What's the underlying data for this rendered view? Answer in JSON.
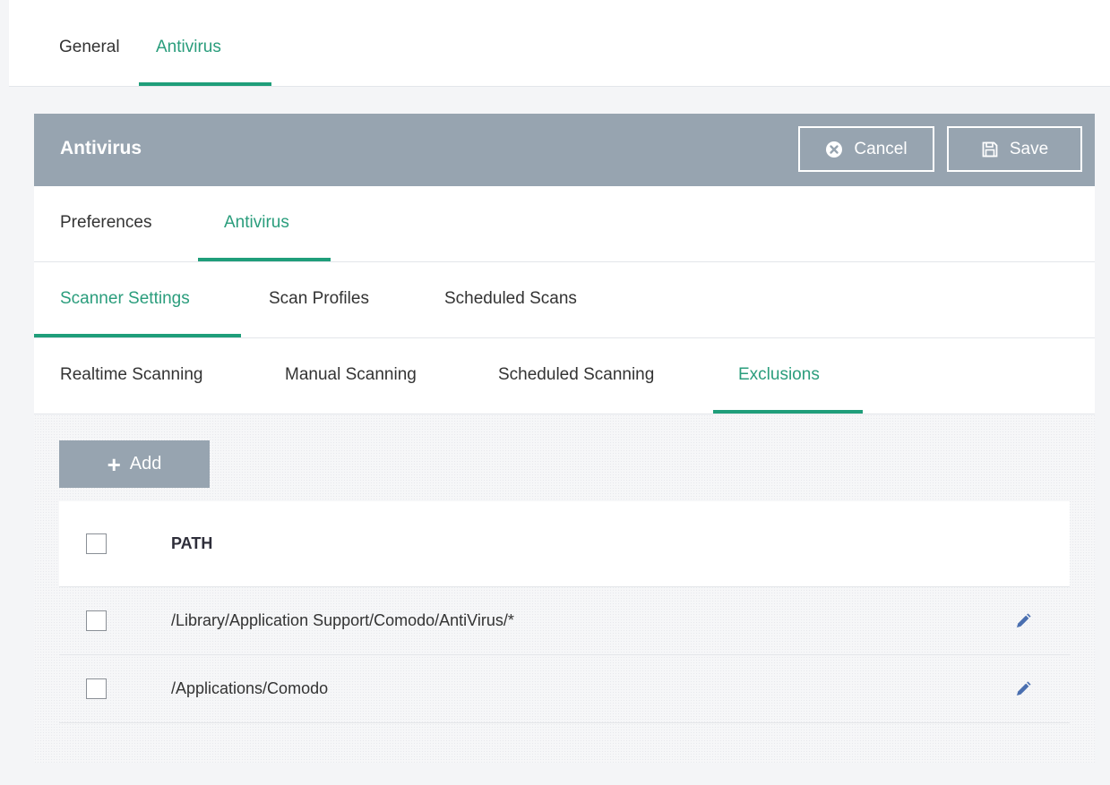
{
  "top_tabs": [
    "General",
    "Antivirus"
  ],
  "panel": {
    "title": "Antivirus",
    "cancel_label": "Cancel",
    "save_label": "Save"
  },
  "level1_tabs": [
    "Preferences",
    "Antivirus"
  ],
  "level2_tabs": [
    "Scanner Settings",
    "Scan Profiles",
    "Scheduled Scans"
  ],
  "level3_tabs": [
    "Realtime Scanning",
    "Manual Scanning",
    "Scheduled Scanning",
    "Exclusions"
  ],
  "add_label": "Add",
  "table": {
    "header": "PATH",
    "rows": [
      {
        "path": "/Library/Application Support/Comodo/AntiVirus/*"
      },
      {
        "path": "/Applications/Comodo"
      }
    ]
  },
  "colors": {
    "accent": "#1f9e7a",
    "header_bg": "#97a4b0"
  },
  "icons": {
    "cancel": "x-circle-icon",
    "save": "floppy-disk-icon",
    "add": "plus-icon",
    "edit": "pencil-icon"
  }
}
